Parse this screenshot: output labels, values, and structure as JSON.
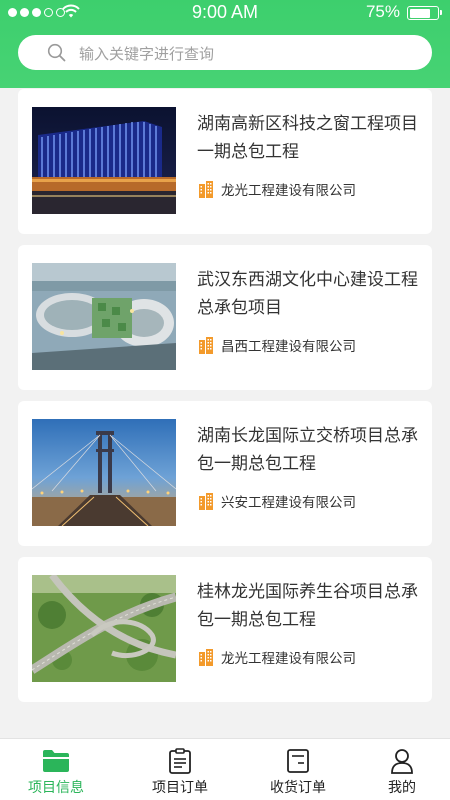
{
  "status_bar": {
    "time": "9:00 AM",
    "battery": "75%",
    "battery_level": 0.75,
    "signal_bars": 3
  },
  "search": {
    "placeholder": "输入关键字进行查询"
  },
  "projects": [
    {
      "title": "湖南高新区科技之窗工程项目一期总包工程",
      "company": "龙光工程建设有限公司",
      "image": "building-night-image"
    },
    {
      "title": "武汉东西湖文化中心建设工程总承包项目",
      "company": "昌西工程建设有限公司",
      "image": "cultural-center-aerial-image"
    },
    {
      "title": "湖南长龙国际立交桥项目总承包一期总包工程",
      "company": "兴安工程建设有限公司",
      "image": "bridge-dusk-image"
    },
    {
      "title": "桂林龙光国际养生谷项目总承包一期总包工程",
      "company": "龙光工程建设有限公司",
      "image": "highway-interchange-image"
    }
  ],
  "tabs": [
    {
      "label": "项目信息",
      "icon": "folder-icon",
      "active": true
    },
    {
      "label": "项目订单",
      "icon": "clipboard-icon",
      "active": false
    },
    {
      "label": "收货订单",
      "icon": "receipt-icon",
      "active": false
    },
    {
      "label": "我的",
      "icon": "user-icon",
      "active": false
    }
  ],
  "colors": {
    "brand_green": "#3dcf6d",
    "active_tab": "#2bb55a",
    "company_icon": "#f39a2b"
  }
}
